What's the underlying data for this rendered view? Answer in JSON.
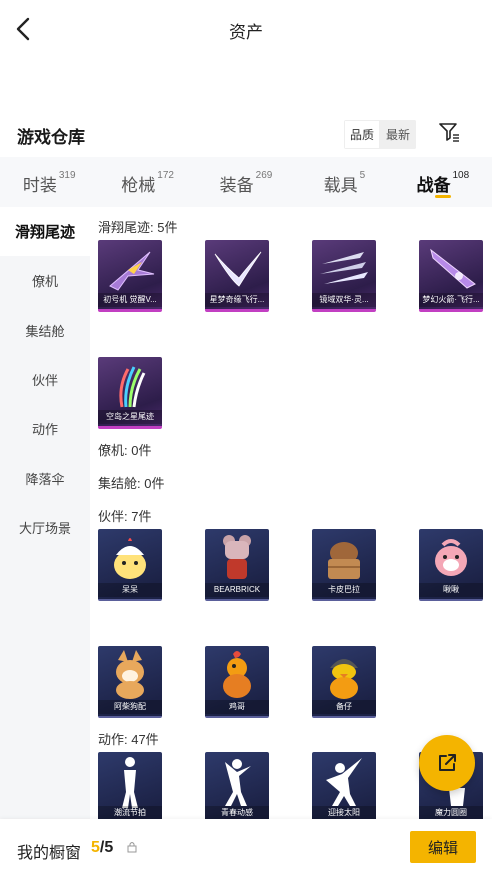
{
  "header": {
    "title": "资产"
  },
  "warehouse": {
    "title": "游戏仓库",
    "sort_quality": "品质",
    "sort_latest": "最新"
  },
  "categories": [
    {
      "label": "时装",
      "count": "319"
    },
    {
      "label": "枪械",
      "count": "172"
    },
    {
      "label": "装备",
      "count": "269"
    },
    {
      "label": "载具",
      "count": "5"
    },
    {
      "label": "战备",
      "count": "108"
    }
  ],
  "sidebar": {
    "items": [
      {
        "label": "滑翔尾迹"
      },
      {
        "label": "僚机"
      },
      {
        "label": "集结舱"
      },
      {
        "label": "伙伴"
      },
      {
        "label": "动作"
      },
      {
        "label": "降落伞"
      },
      {
        "label": "大厅场景"
      }
    ]
  },
  "sections": {
    "trails": {
      "label": "滑翔尾迹: 5件",
      "items": [
        {
          "name": "初号机 觉醒V..."
        },
        {
          "name": "星梦奇缘飞行..."
        },
        {
          "name": "镜域双华·灵..."
        },
        {
          "name": "梦幻火箭·飞行..."
        },
        {
          "name": "空岛之星尾迹"
        }
      ]
    },
    "wingman": {
      "label": "僚机: 0件"
    },
    "pod": {
      "label": "集结舱: 0件"
    },
    "companions": {
      "label": "伙伴: 7件",
      "items": [
        {
          "name": "呆呆"
        },
        {
          "name": "BEARBRICK"
        },
        {
          "name": "卡皮巴拉"
        },
        {
          "name": "啾啾"
        },
        {
          "name": "阿柴狗配"
        },
        {
          "name": "鸡哥"
        },
        {
          "name": "备仔"
        }
      ]
    },
    "emotes": {
      "label": "动作: 47件",
      "items": [
        {
          "name": "潮流节拍"
        },
        {
          "name": "青春动感"
        },
        {
          "name": "迎接太阳"
        },
        {
          "name": "魔力圆圈"
        }
      ]
    }
  },
  "bottom": {
    "window_label": "我的橱窗",
    "count_current": "5",
    "count_total": "/5",
    "edit_label": "编辑"
  },
  "colors": {
    "accent": "#f4b400",
    "trail_rarity": "#c23fc2"
  }
}
